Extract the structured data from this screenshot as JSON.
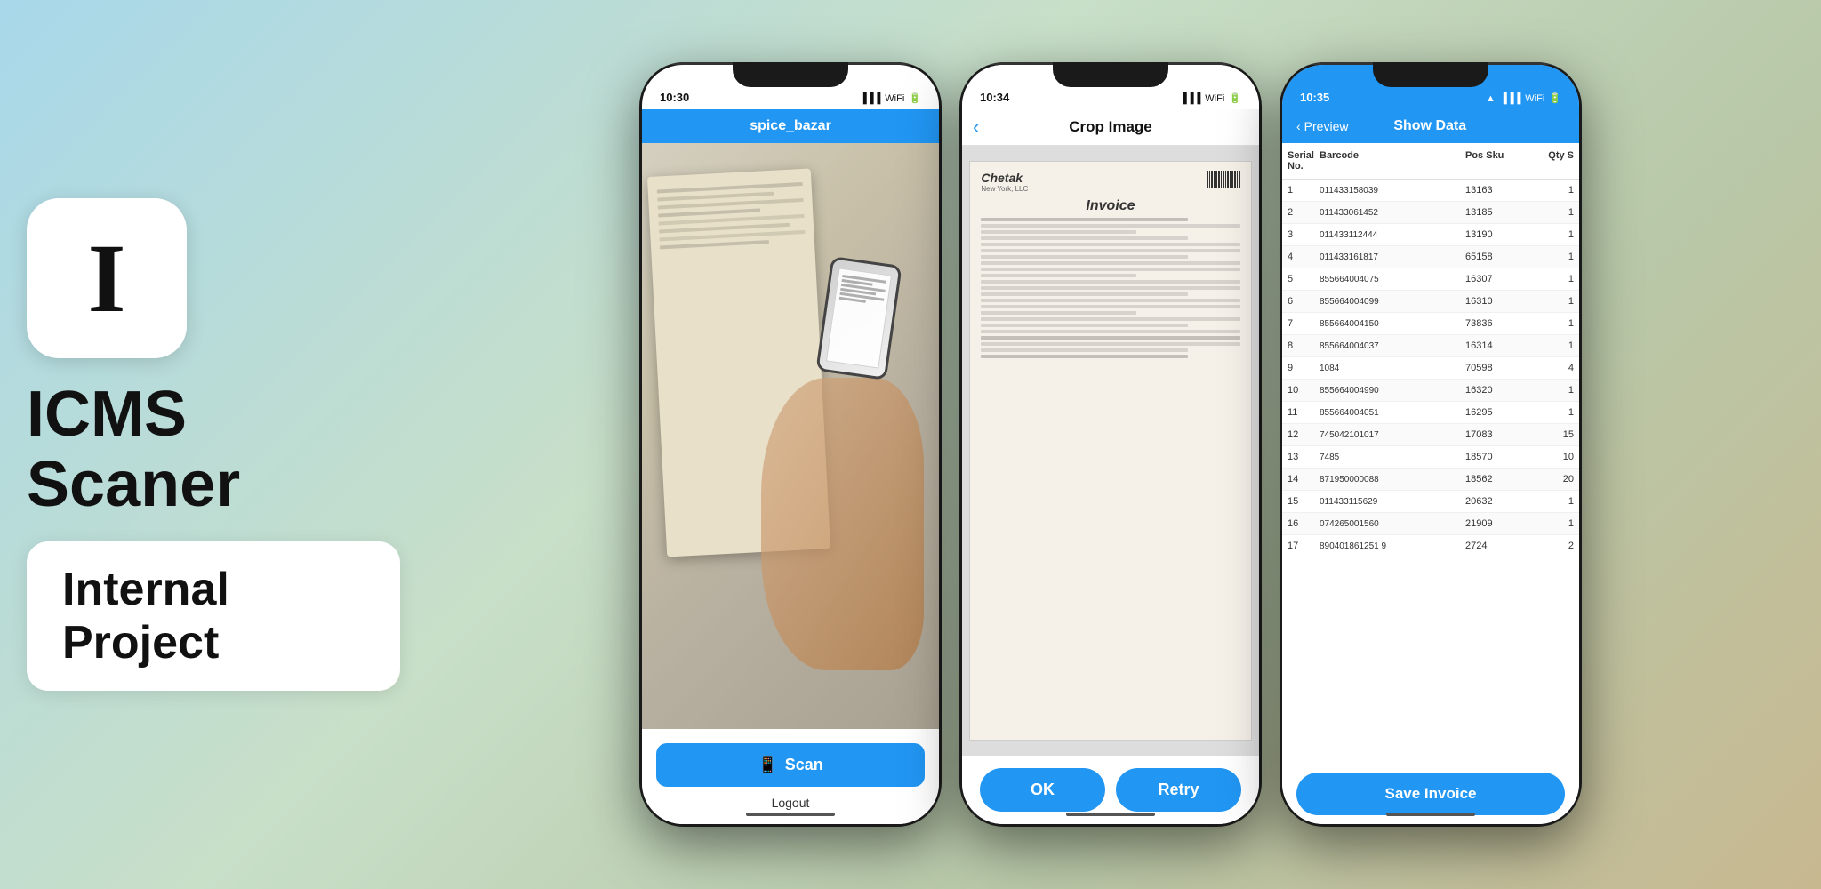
{
  "branding": {
    "icon_letter": "I",
    "app_name_line1": "ICMS",
    "app_name_line2": "Scaner",
    "project_label": "Internal Project"
  },
  "phone1": {
    "status_time": "10:30",
    "nav_title": "spice_bazar",
    "scan_button_label": "Scan",
    "scan_icon": "📱",
    "logout_label": "Logout"
  },
  "phone2": {
    "status_time": "10:34",
    "nav_title": "Crop Image",
    "ok_label": "OK",
    "retry_label": "Retry"
  },
  "phone3": {
    "status_time": "10:35",
    "nav_back_label": "Preview",
    "nav_title": "Show Data",
    "columns": {
      "serial": "Serial No.",
      "barcode": "Barcode",
      "pos_sku": "Pos Sku",
      "qty": "Qty S"
    },
    "rows": [
      {
        "serial": "1",
        "barcode": "011433158039",
        "sku": "13163",
        "qty": "1"
      },
      {
        "serial": "2",
        "barcode": "011433061452",
        "sku": "13185",
        "qty": "1"
      },
      {
        "serial": "3",
        "barcode": "011433112444",
        "sku": "13190",
        "qty": "1"
      },
      {
        "serial": "4",
        "barcode": "011433161817",
        "sku": "65158",
        "qty": "1"
      },
      {
        "serial": "5",
        "barcode": "855664004075",
        "sku": "16307",
        "qty": "1"
      },
      {
        "serial": "6",
        "barcode": "855664004099",
        "sku": "16310",
        "qty": "1"
      },
      {
        "serial": "7",
        "barcode": "855664004150",
        "sku": "73836",
        "qty": "1"
      },
      {
        "serial": "8",
        "barcode": "855664004037",
        "sku": "16314",
        "qty": "1"
      },
      {
        "serial": "9",
        "barcode": "1084",
        "sku": "70598",
        "qty": "4"
      },
      {
        "serial": "10",
        "barcode": "855664004990",
        "sku": "16320",
        "qty": "1"
      },
      {
        "serial": "11",
        "barcode": "855664004051",
        "sku": "16295",
        "qty": "1"
      },
      {
        "serial": "12",
        "barcode": "745042101017",
        "sku": "17083",
        "qty": "15"
      },
      {
        "serial": "13",
        "barcode": "7485",
        "sku": "18570",
        "qty": "10"
      },
      {
        "serial": "14",
        "barcode": "871950000088",
        "sku": "18562",
        "qty": "20"
      },
      {
        "serial": "15",
        "barcode": "011433115629",
        "sku": "20632",
        "qty": "1"
      },
      {
        "serial": "16",
        "barcode": "074265001560",
        "sku": "21909",
        "qty": "1"
      },
      {
        "serial": "17",
        "barcode": "890401861251 9",
        "sku": "2724",
        "qty": "2"
      }
    ],
    "save_button_label": "Save Invoice"
  }
}
